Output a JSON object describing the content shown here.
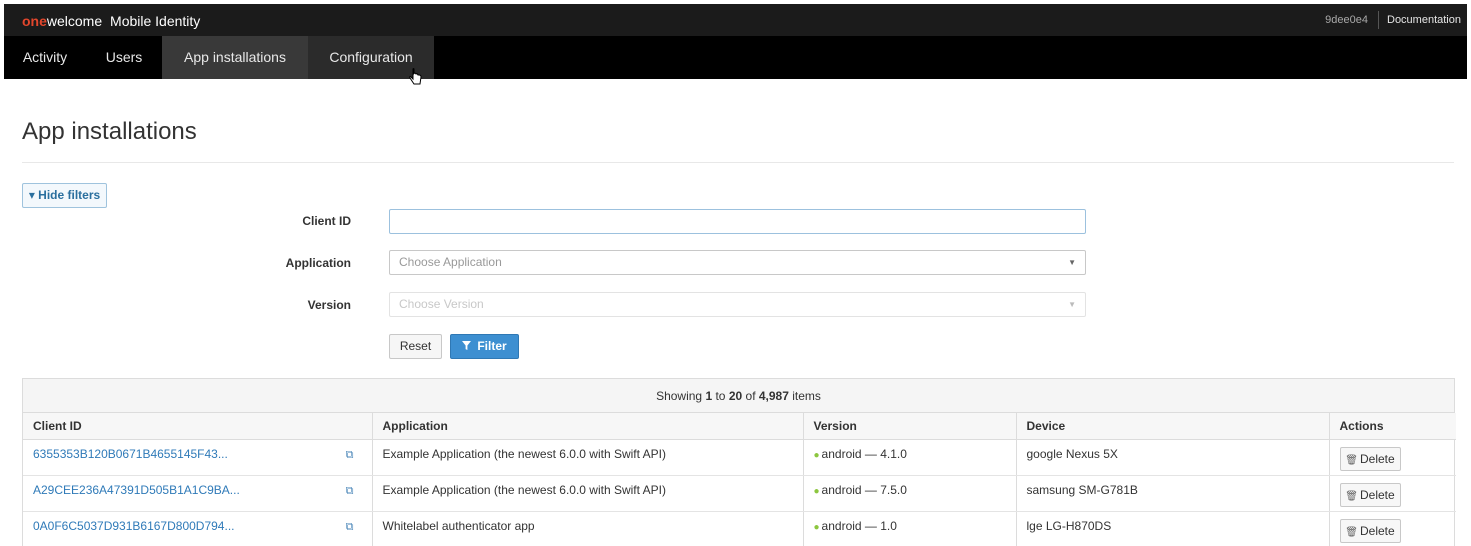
{
  "brand": {
    "one": "one",
    "welcome": "welcome",
    "product": "Mobile Identity"
  },
  "topbar": {
    "hash": "9dee0e4",
    "documentation": "Documentation"
  },
  "nav": {
    "tabs": [
      "Activity",
      "Users",
      "App installations",
      "Configuration"
    ],
    "active": "App installations"
  },
  "page": {
    "title": "App installations"
  },
  "filters": {
    "toggle_label": "▾ Hide filters",
    "client_id_label": "Client ID",
    "client_id_value": "",
    "application_label": "Application",
    "application_placeholder": "Choose Application",
    "version_label": "Version",
    "version_placeholder": "Choose Version",
    "reset_label": "Reset",
    "filter_label": "Filter"
  },
  "table": {
    "showing_prefix": "Showing ",
    "showing_from": "1",
    "showing_to_word": " to ",
    "showing_to": "20",
    "showing_of_word": " of ",
    "showing_total": "4,987",
    "showing_suffix": " items",
    "headers": [
      "Client ID",
      "Application",
      "Version",
      "Device",
      "Actions"
    ],
    "rows": [
      {
        "client_id": "6355353B120B0671B4655145F43...",
        "application": "Example Application (the newest 6.0.0 with Swift API)",
        "version": "android — 4.1.0",
        "device": "google Nexus 5X",
        "action": "Delete"
      },
      {
        "client_id": "A29CEE236A47391D505B1A1C9BA...",
        "application": "Example Application (the newest 6.0.0 with Swift API)",
        "version": "android — 7.5.0",
        "device": "samsung SM-G781B",
        "action": "Delete"
      },
      {
        "client_id": "0A0F6C5037D931B6167D800D794...",
        "application": "Whitelabel authenticator app",
        "version": "android — 1.0",
        "device": "lge LG-H870DS",
        "action": "Delete"
      }
    ]
  },
  "colors": {
    "topbar": "#1b1b1b",
    "nav_active": "#393939",
    "link": "#2f7ab8",
    "filter_button": "#3d8fd1",
    "brand_accent": "#e2462c",
    "android": "#8cc63f"
  },
  "icons": {
    "copy": "copy-icon",
    "android": "android-icon",
    "trash": "trash-icon",
    "filter": "filter-icon",
    "cursor": "hand-pointer-icon"
  }
}
